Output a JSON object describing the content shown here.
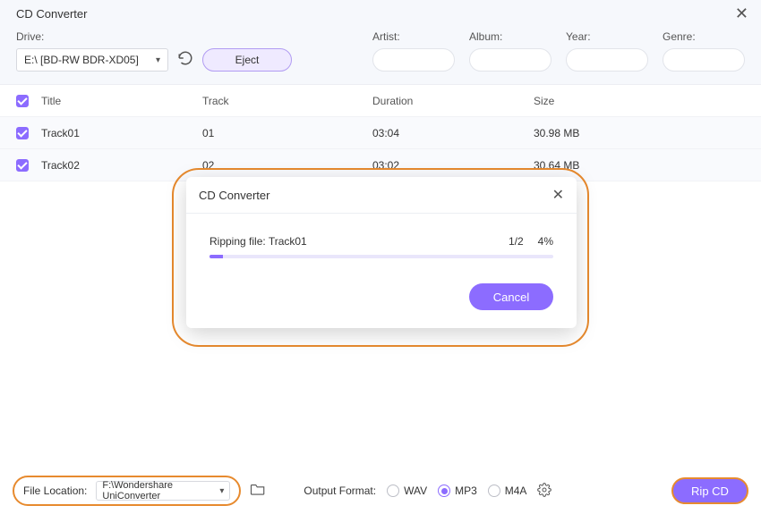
{
  "window": {
    "title": "CD Converter"
  },
  "toolbar": {
    "drive_label": "Drive:",
    "drive_value": "E:\\ [BD-RW  BDR-XD05]",
    "eject_label": "Eject",
    "artist_label": "Artist:",
    "album_label": "Album:",
    "year_label": "Year:",
    "genre_label": "Genre:",
    "artist_value": "",
    "album_value": "",
    "year_value": "",
    "genre_value": ""
  },
  "columns": {
    "title": "Title",
    "track": "Track",
    "duration": "Duration",
    "size": "Size"
  },
  "tracks": [
    {
      "checked": true,
      "title": "Track01",
      "track": "01",
      "duration": "03:04",
      "size": "30.98 MB"
    },
    {
      "checked": true,
      "title": "Track02",
      "track": "02",
      "duration": "03:02",
      "size": "30.64 MB"
    }
  ],
  "modal": {
    "title": "CD Converter",
    "status": "Ripping file: Track01",
    "counter": "1/2",
    "percent": "4%",
    "cancel_label": "Cancel"
  },
  "footer": {
    "file_location_label": "File Location:",
    "file_location_value": "F:\\Wondershare UniConverter",
    "output_format_label": "Output Format:",
    "formats": [
      {
        "label": "WAV",
        "selected": false
      },
      {
        "label": "MP3",
        "selected": true
      },
      {
        "label": "M4A",
        "selected": false
      }
    ],
    "rip_label": "Rip CD"
  }
}
